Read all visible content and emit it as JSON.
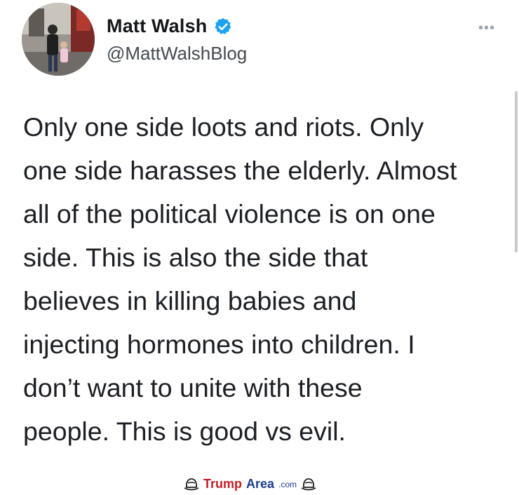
{
  "tweet": {
    "author": {
      "display_name": "Matt Walsh",
      "handle": "@MattWalshBlog",
      "verified": true,
      "avatar_icon": "profile-photo"
    },
    "more_icon": "more-options-icon",
    "text": "Only one side loots and riots. Only\none side harasses the elderly. Almost\nall of the political violence is on one\nside. This is also the side that\nbelieves in killing babies and\ninjecting hormones into children. I\ndon’t want to unite with these\npeople. This is good vs evil."
  },
  "watermark": {
    "part1": "Trump",
    "part2": "Area",
    "part3": ".com",
    "colors": {
      "part1": "#c41e25",
      "part2": "#1d3d8f"
    }
  },
  "colors": {
    "verified_badge": "#1da1f2",
    "text": "#1c1f23",
    "handle": "#444a4f"
  }
}
